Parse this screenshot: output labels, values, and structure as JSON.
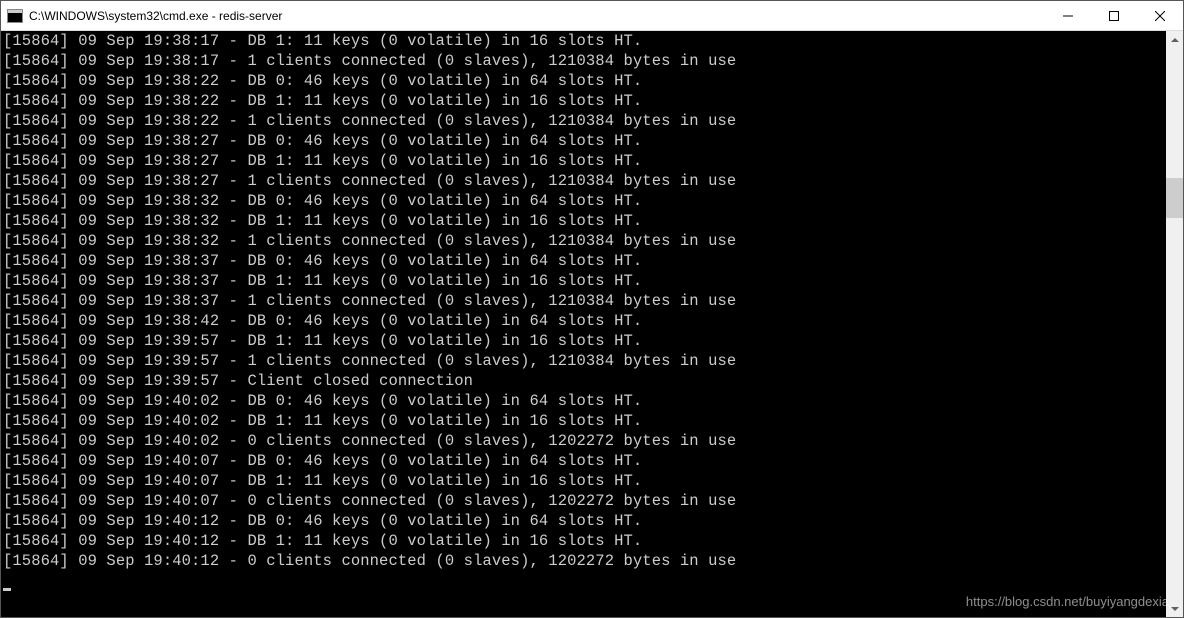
{
  "window": {
    "title": "C:\\WINDOWS\\system32\\cmd.exe - redis-server"
  },
  "watermark": "https://blog.csdn.net/buyiyangdexia",
  "log": {
    "pid": "15864",
    "lines": [
      "[15864] 09 Sep 19:38:17 - DB 1: 11 keys (0 volatile) in 16 slots HT.",
      "[15864] 09 Sep 19:38:17 - 1 clients connected (0 slaves), 1210384 bytes in use",
      "[15864] 09 Sep 19:38:22 - DB 0: 46 keys (0 volatile) in 64 slots HT.",
      "[15864] 09 Sep 19:38:22 - DB 1: 11 keys (0 volatile) in 16 slots HT.",
      "[15864] 09 Sep 19:38:22 - 1 clients connected (0 slaves), 1210384 bytes in use",
      "[15864] 09 Sep 19:38:27 - DB 0: 46 keys (0 volatile) in 64 slots HT.",
      "[15864] 09 Sep 19:38:27 - DB 1: 11 keys (0 volatile) in 16 slots HT.",
      "[15864] 09 Sep 19:38:27 - 1 clients connected (0 slaves), 1210384 bytes in use",
      "[15864] 09 Sep 19:38:32 - DB 0: 46 keys (0 volatile) in 64 slots HT.",
      "[15864] 09 Sep 19:38:32 - DB 1: 11 keys (0 volatile) in 16 slots HT.",
      "[15864] 09 Sep 19:38:32 - 1 clients connected (0 slaves), 1210384 bytes in use",
      "[15864] 09 Sep 19:38:37 - DB 0: 46 keys (0 volatile) in 64 slots HT.",
      "[15864] 09 Sep 19:38:37 - DB 1: 11 keys (0 volatile) in 16 slots HT.",
      "[15864] 09 Sep 19:38:37 - 1 clients connected (0 slaves), 1210384 bytes in use",
      "[15864] 09 Sep 19:38:42 - DB 0: 46 keys (0 volatile) in 64 slots HT.",
      "[15864] 09 Sep 19:39:57 - DB 1: 11 keys (0 volatile) in 16 slots HT.",
      "[15864] 09 Sep 19:39:57 - 1 clients connected (0 slaves), 1210384 bytes in use",
      "[15864] 09 Sep 19:39:57 - Client closed connection",
      "[15864] 09 Sep 19:40:02 - DB 0: 46 keys (0 volatile) in 64 slots HT.",
      "[15864] 09 Sep 19:40:02 - DB 1: 11 keys (0 volatile) in 16 slots HT.",
      "[15864] 09 Sep 19:40:02 - 0 clients connected (0 slaves), 1202272 bytes in use",
      "[15864] 09 Sep 19:40:07 - DB 0: 46 keys (0 volatile) in 64 slots HT.",
      "[15864] 09 Sep 19:40:07 - DB 1: 11 keys (0 volatile) in 16 slots HT.",
      "[15864] 09 Sep 19:40:07 - 0 clients connected (0 slaves), 1202272 bytes in use",
      "[15864] 09 Sep 19:40:12 - DB 0: 46 keys (0 volatile) in 64 slots HT.",
      "[15864] 09 Sep 19:40:12 - DB 1: 11 keys (0 volatile) in 16 slots HT.",
      "[15864] 09 Sep 19:40:12 - 0 clients connected (0 slaves), 1202272 bytes in use"
    ]
  }
}
